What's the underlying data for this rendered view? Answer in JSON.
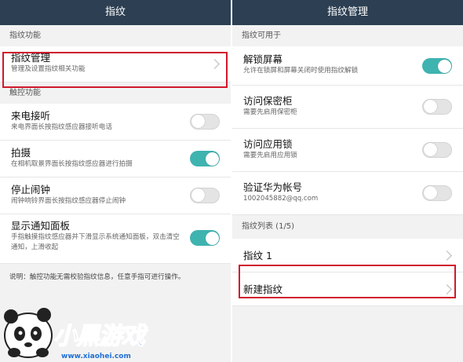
{
  "left": {
    "title": "指纹",
    "section1": "指纹功能",
    "manage": {
      "title": "指纹管理",
      "sub": "管理及设置指纹相关功能"
    },
    "section2": "触控功能",
    "items": [
      {
        "title": "来电接听",
        "sub": "来电界面长按指纹感应器接听电话",
        "on": false
      },
      {
        "title": "拍摄",
        "sub": "在相机取景界面长按指纹感应器进行拍摄",
        "on": true
      },
      {
        "title": "停止闹钟",
        "sub": "闹钟响铃界面长按指纹感应器停止闹钟",
        "on": false
      },
      {
        "title": "显示通知面板",
        "sub": "手指触摸指纹感应器并下滑显示系统通知面板，双击清空通知，上滑收起",
        "on": true
      }
    ],
    "note": "说明：触控功能无需校验指纹信息，任意手指可进行操作。"
  },
  "right": {
    "title": "指纹管理",
    "section1": "指纹可用于",
    "items": [
      {
        "title": "解锁屏幕",
        "sub": "允许在锁屏和屏幕关闭时使用指纹解锁",
        "on": true
      },
      {
        "title": "访问保密柜",
        "sub": "需要先启用保密柜",
        "on": false
      },
      {
        "title": "访问应用锁",
        "sub": "需要先启用应用锁",
        "on": false
      },
      {
        "title": "验证华为帐号",
        "sub": "1002045882@qq.com",
        "on": false
      }
    ],
    "section2": "指纹列表 (1/5)",
    "fingerprint1": "指纹 1",
    "new_fingerprint": "新建指纹"
  },
  "watermark": {
    "logo_text": "小黑游戏",
    "url": "www.xiaohei.com"
  },
  "colors": {
    "titlebar": "#2c3f53",
    "toggle_on": "#3fb3b0",
    "highlight": "#d0182c"
  }
}
